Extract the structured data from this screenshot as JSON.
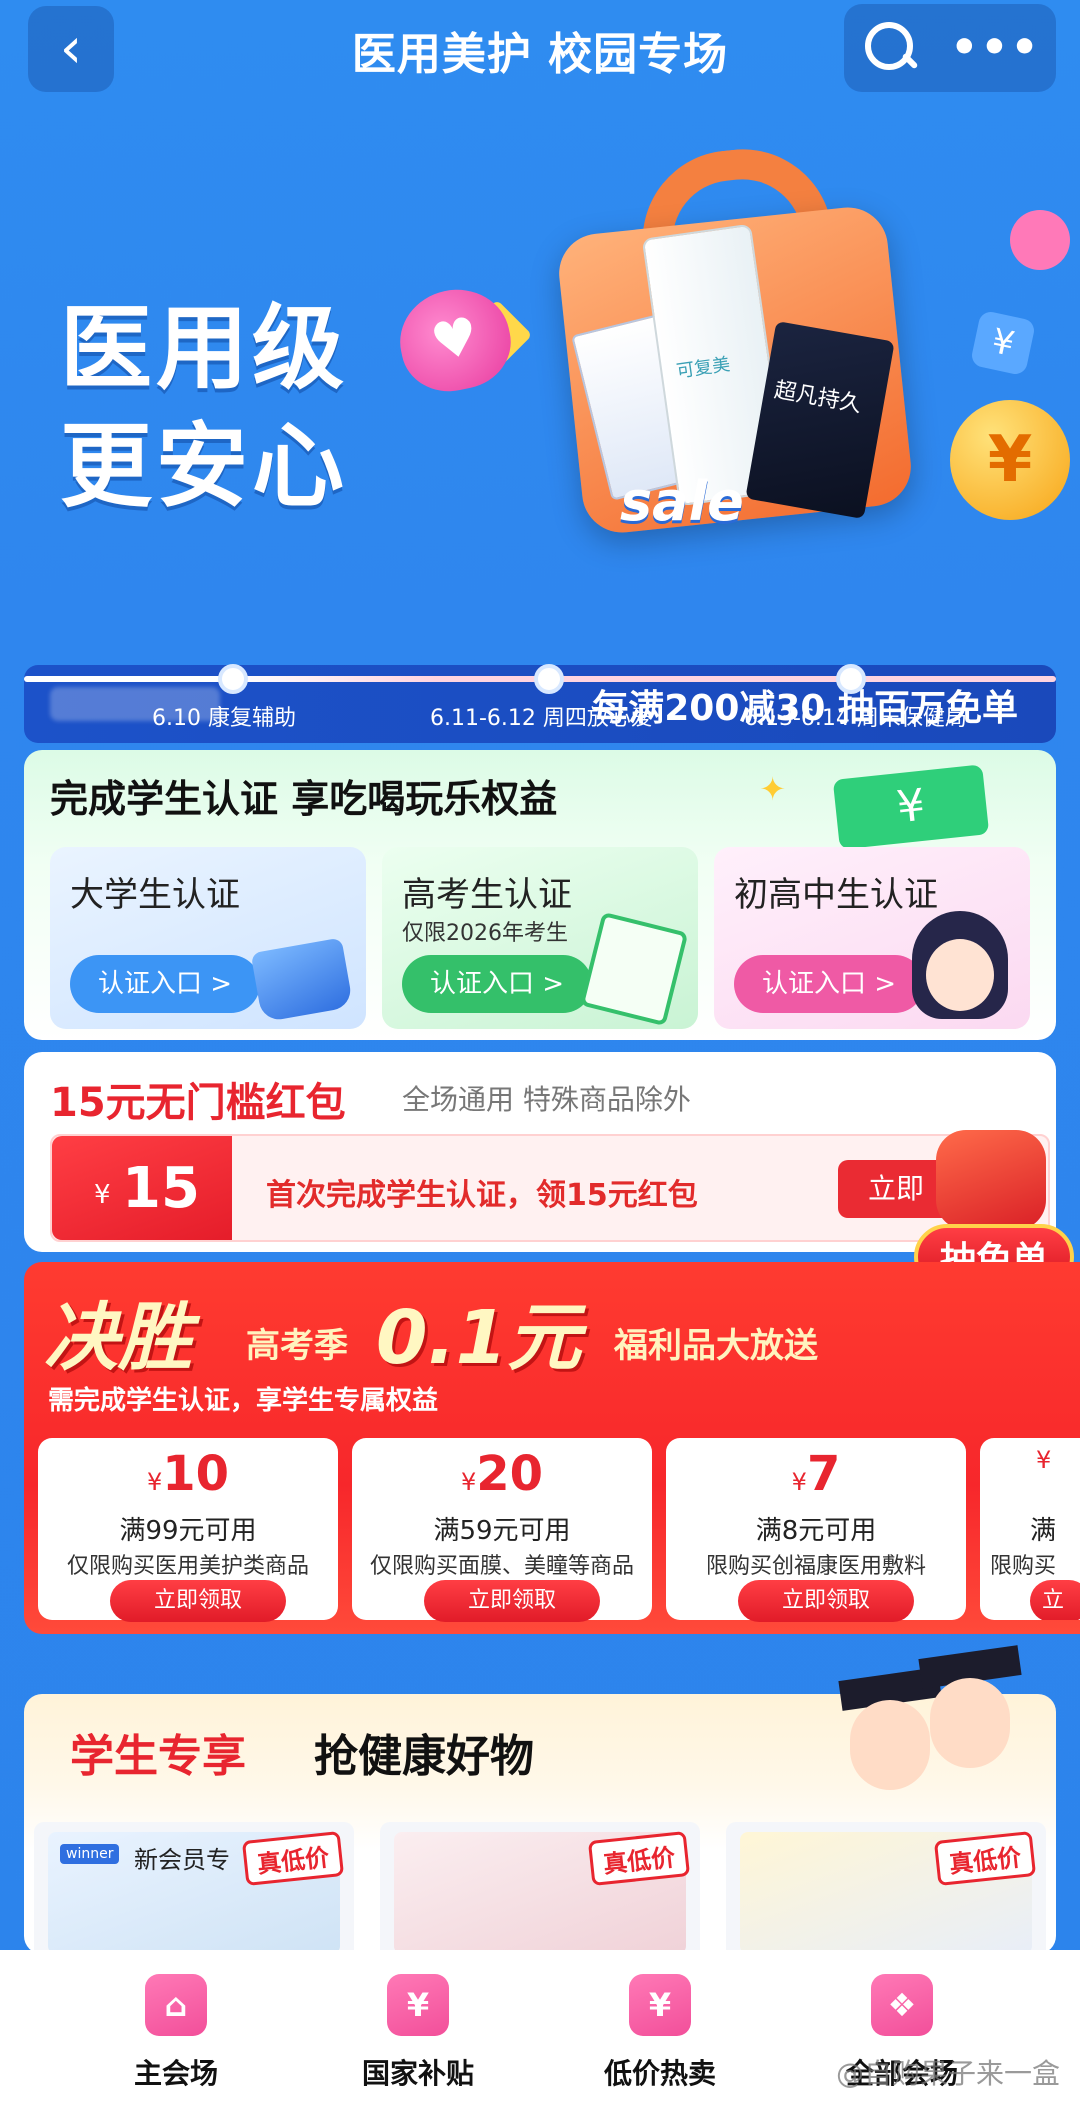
{
  "header": {
    "title": "医用美护 校园专场",
    "back_icon": "chevron-left-icon",
    "search_icon": "search-icon",
    "more_label": "•••"
  },
  "hero": {
    "headline_line1": "医用级",
    "headline_line2": "更安心",
    "sale_label": "sale",
    "tube_label": "可复美",
    "box_label": "超凡持久",
    "yen": "¥",
    "promo": "每满200减30 抽百万免单"
  },
  "timeline": [
    {
      "label": "6.10 康复辅助"
    },
    {
      "label": "6.11-6.12 周四放心爱"
    },
    {
      "label": "6.13-6.14 周末保健局"
    }
  ],
  "auth": {
    "title": "完成学生认证 享吃喝玩乐权益",
    "tiles": [
      {
        "title": "大学生认证",
        "sub": "",
        "button": "认证入口 >",
        "icon": "graduation-cap-icon"
      },
      {
        "title": "高考生认证",
        "sub": "仅限2026年考生",
        "button": "认证入口 >",
        "icon": "notebook-pen-icon"
      },
      {
        "title": "初高中生认证",
        "sub": "",
        "button": "认证入口 >",
        "icon": "student-girl-icon"
      }
    ]
  },
  "packet": {
    "title": "15元无门槛红包",
    "subtitle": "全场通用 特殊商品除外",
    "yen": "¥",
    "amount": "15",
    "desc": "首次完成学生认证，领15元红包",
    "button": "立即",
    "mascot_label": "抽免单"
  },
  "gaokao": {
    "big1": "决胜",
    "mid": "高考季",
    "big2": "0.1元",
    "tag": "福利品大放送",
    "requirement": "需完成学生认证，享学生专属权益",
    "coupons": [
      {
        "yen": "¥",
        "amount": "10",
        "condition": "满99元可用",
        "scope": "仅限购买医用美护类商品",
        "button": "立即领取"
      },
      {
        "yen": "¥",
        "amount": "20",
        "condition": "满59元可用",
        "scope": "仅限购买面膜、美瞳等商品",
        "button": "立即领取"
      },
      {
        "yen": "¥",
        "amount": "7",
        "condition": "满8元可用",
        "scope": "限购买创福康医用敷料",
        "button": "立即领取"
      },
      {
        "yen": "¥",
        "amount": "",
        "condition": "满",
        "scope": "限购买",
        "button": "立"
      }
    ]
  },
  "exclusive": {
    "title_red": "学生专享",
    "title_black": "抢健康好物",
    "products": [
      {
        "tag": "真低价",
        "brand": "winner",
        "name": "新会员专"
      },
      {
        "tag": "真低价",
        "brand": "",
        "name": ""
      },
      {
        "tag": "真低价",
        "brand": "",
        "name": ""
      }
    ]
  },
  "bottom_nav": [
    {
      "label": "主会场",
      "icon": "home-icon",
      "glyph": "⌂"
    },
    {
      "label": "国家补贴",
      "icon": "money-bag-icon",
      "glyph": "¥"
    },
    {
      "label": "低价热卖",
      "icon": "price-down-icon",
      "glyph": "¥"
    },
    {
      "label": "全部会场",
      "icon": "grid-icon",
      "glyph": "❖"
    }
  ],
  "watermark": "@自购果子来一盒",
  "colors": {
    "background": "#2f86ee",
    "accent_red": "#e8252f",
    "accent_pink": "#f24f9a",
    "accent_green": "#34c06a",
    "accent_blue": "#3c95f5"
  }
}
